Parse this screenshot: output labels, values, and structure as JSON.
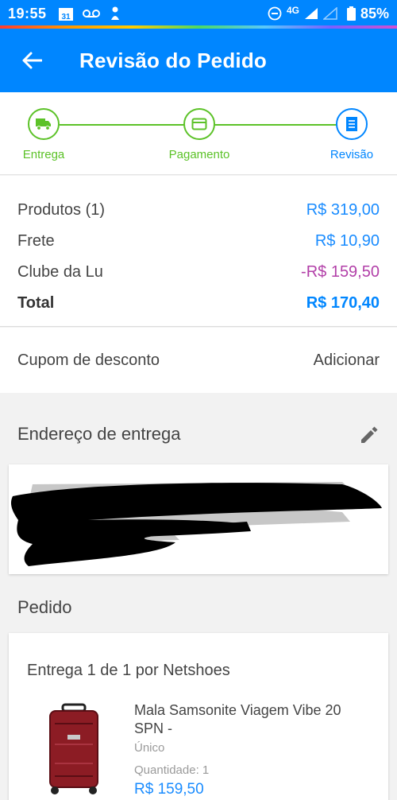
{
  "status_bar": {
    "time": "19:55",
    "calendar_day": "31",
    "network": "4G",
    "battery": "85%"
  },
  "app_bar": {
    "title": "Revisão do Pedido"
  },
  "stepper": {
    "steps": [
      {
        "label": "Entrega",
        "icon": "truck-icon",
        "state": "done"
      },
      {
        "label": "Pagamento",
        "icon": "credit-card-icon",
        "state": "done"
      },
      {
        "label": "Revisão",
        "icon": "receipt-icon",
        "state": "active"
      }
    ]
  },
  "summary": {
    "rows": [
      {
        "label": "Produtos (1)",
        "value": "R$ 319,00"
      },
      {
        "label": "Frete",
        "value": "R$ 10,90"
      },
      {
        "label": "Clube da Lu",
        "value": "-R$ 159,50"
      }
    ],
    "total": {
      "label": "Total",
      "value": "R$ 170,40"
    }
  },
  "coupon": {
    "label": "Cupom de desconto",
    "action": "Adicionar"
  },
  "address": {
    "heading": "Endereço de entrega"
  },
  "order": {
    "heading": "Pedido",
    "delivery_title": "Entrega 1 de 1 por Netshoes",
    "product": {
      "name": "Mala Samsonite Viagem Vibe 20 SPN -",
      "variant": "Único",
      "quantity": "Quantidade:  1",
      "price": "R$ 159,50"
    }
  },
  "colors": {
    "primary": "#0086ff",
    "step_done": "#5cc228",
    "discount": "#b23fa8",
    "background": "#f2f2f2"
  }
}
